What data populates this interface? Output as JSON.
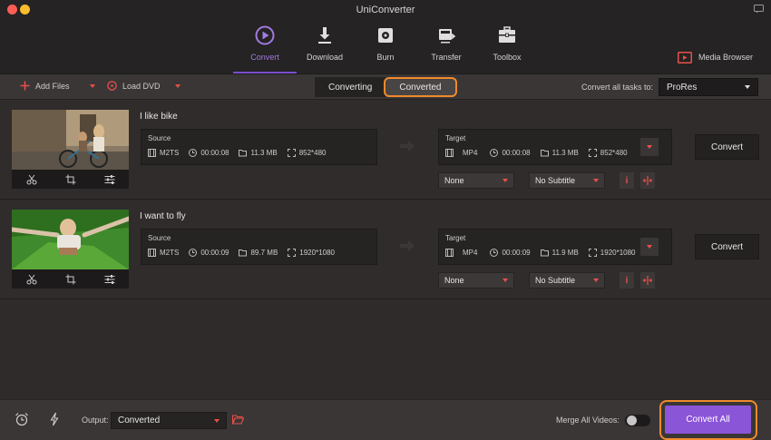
{
  "window": {
    "title": "UniConverter"
  },
  "toolbar": {
    "tabs": [
      {
        "label": "Convert",
        "icon": "convert-icon",
        "active": true
      },
      {
        "label": "Download",
        "icon": "download-icon",
        "active": false
      },
      {
        "label": "Burn",
        "icon": "burn-icon",
        "active": false
      },
      {
        "label": "Transfer",
        "icon": "transfer-icon",
        "active": false
      },
      {
        "label": "Toolbox",
        "icon": "toolbox-icon",
        "active": false
      }
    ],
    "media_browser": "Media Browser"
  },
  "subbar": {
    "add_files": "Add Files",
    "load_dvd": "Load DVD",
    "segments": {
      "converting": "Converting",
      "converted": "Converted"
    },
    "convert_all_label": "Convert all tasks to:",
    "format": "ProRes"
  },
  "tasks": [
    {
      "name": "I like bike",
      "source": {
        "title": "Source",
        "format": "M2TS",
        "duration": "00:00:08",
        "size": "11.3 MB",
        "resolution": "852*480"
      },
      "target": {
        "title": "Target",
        "format": "MP4",
        "duration": "00:00:08",
        "size": "11.3 MB",
        "resolution": "852*480"
      },
      "audio": "None",
      "subtitle": "No Subtitle",
      "convert": "Convert"
    },
    {
      "name": "I want to fly",
      "source": {
        "title": "Source",
        "format": "M2TS",
        "duration": "00:00:09",
        "size": "89.7 MB",
        "resolution": "1920*1080"
      },
      "target": {
        "title": "Target",
        "format": "MP4",
        "duration": "00:00:09",
        "size": "11.9 MB",
        "resolution": "1920*1080"
      },
      "audio": "None",
      "subtitle": "No Subtitle",
      "convert": "Convert"
    }
  ],
  "bottom": {
    "output_label": "Output:",
    "output_value": "Converted",
    "merge_label": "Merge All Videos:",
    "merge_enabled": false,
    "convert_all": "Convert All"
  },
  "colors": {
    "accent": "#8b55d8",
    "highlight": "#f08a2b",
    "warning": "#e8504a"
  }
}
